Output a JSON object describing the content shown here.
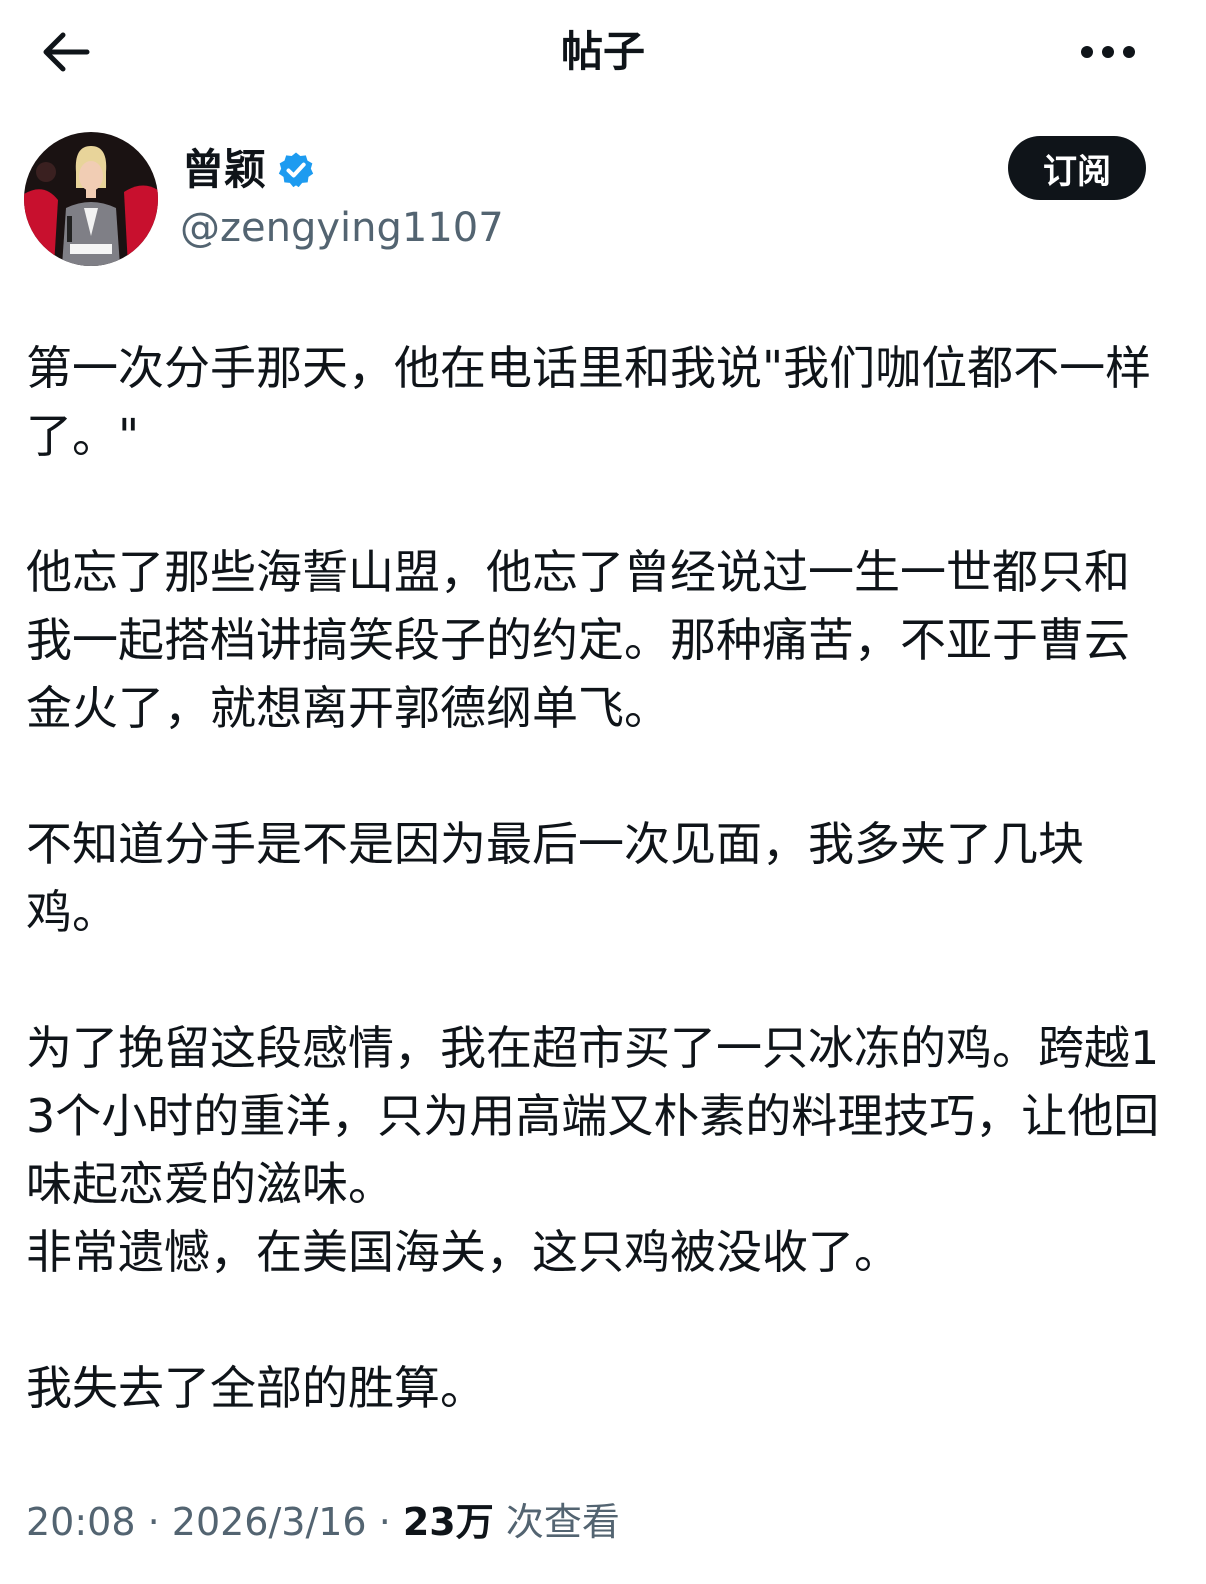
{
  "header": {
    "back_icon": "arrow-left-icon",
    "title": "帖子",
    "more_icon": "more-horizontal-icon"
  },
  "author": {
    "display_name": "曾颖",
    "verified_icon": "verified-badge-icon",
    "verified_color": "#1d9bf0",
    "handle": "@zengying1107",
    "subscribe_label": "订阅"
  },
  "post": {
    "text": "第一次分手那天，他在电话里和我说\"我们咖位都不一样了。\"\n\n他忘了那些海誓山盟，他忘了曾经说过一生一世都只和我一起搭档讲搞笑段子的约定。那种痛苦，不亚于曹云金火了，就想离开郭德纲单飞。\n\n不知道分手是不是因为最后一次见面，我多夹了几块鸡。\n\n为了挽留这段感情，我在超市买了一只冰冻的鸡。跨越13个小时的重洋，只为用高端又朴素的料理技巧，让他回味起恋爱的滋味。\n非常遗憾，在美国海关，这只鸡被没收了。\n\n我失去了全部的胜算。"
  },
  "meta": {
    "time": "20:08",
    "separator": " · ",
    "date": "2026/3/16",
    "views_count": "23万",
    "views_label": " 次查看"
  },
  "colors": {
    "text_primary": "#0f1419",
    "text_secondary": "#536471",
    "button_bg": "#0f1419",
    "button_text": "#ffffff"
  }
}
